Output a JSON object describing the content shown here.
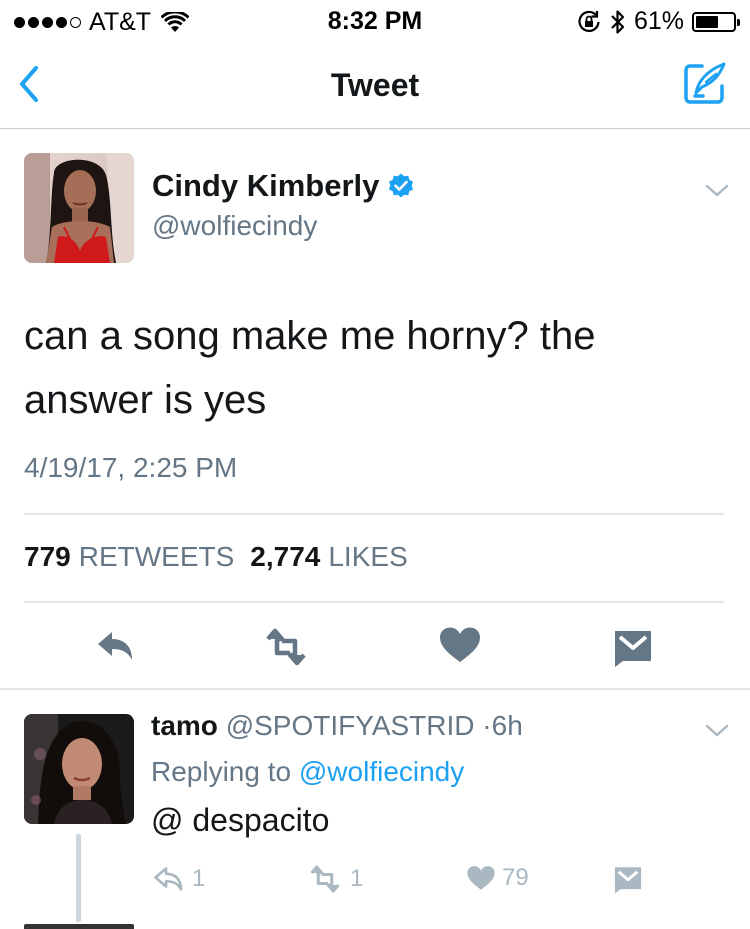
{
  "status_bar": {
    "carrier": "AT&T",
    "time": "8:32 PM",
    "battery_percent": "61%",
    "battery_level": 0.61,
    "signal_bars_filled": 4,
    "signal_bars_total": 5
  },
  "nav": {
    "title": "Tweet",
    "back_icon": "chevron-left-icon",
    "compose_icon": "compose-tweet-icon"
  },
  "tweet": {
    "author_name": "Cindy Kimberly",
    "author_handle": "@wolfiecindy",
    "verified": true,
    "text_line1": "can a song make me horny? the",
    "text_line2": "answer is yes",
    "timestamp": "4/19/17, 2:25 PM",
    "retweets_count": "779",
    "retweets_label": "RETWEETS",
    "likes_count": "2,774",
    "likes_label": "LIKES"
  },
  "reply": {
    "author_name": "tamo",
    "author_handle": "@SPOTIFYASTRID",
    "separator": "·",
    "time_ago": "6h",
    "replying_prefix": "Replying to",
    "replying_handle": "@wolfiecindy",
    "text": "@ despacito",
    "reply_count": "1",
    "retweet_count": "1",
    "like_count": "79"
  },
  "colors": {
    "accent": "#1da1f2",
    "text_primary": "#14171a",
    "text_secondary": "#657786",
    "icon_gray": "#657786",
    "icon_light": "#aab8c2",
    "divider": "#e1e8ed"
  }
}
